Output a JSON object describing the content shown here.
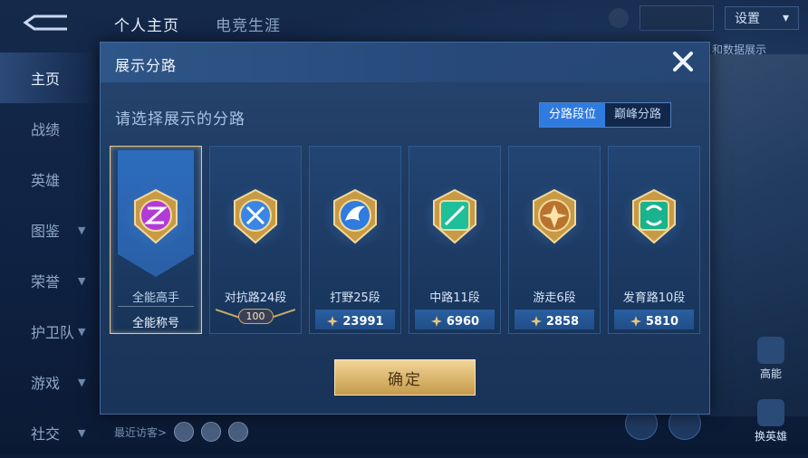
{
  "app": {
    "top_tabs": [
      "个人主页",
      "电竞生涯"
    ],
    "settings_label": "设置",
    "sidebar": [
      {
        "label": "主页",
        "has_chevron": false
      },
      {
        "label": "战绩",
        "has_chevron": false
      },
      {
        "label": "英雄",
        "has_chevron": false
      },
      {
        "label": "图鉴",
        "has_chevron": true
      },
      {
        "label": "荣誉",
        "has_chevron": true
      },
      {
        "label": "护卫队",
        "has_chevron": true
      },
      {
        "label": "游戏",
        "has_chevron": true
      },
      {
        "label": "社交",
        "has_chevron": true
      }
    ],
    "recent_visitors_label": "最近访客>",
    "behind_text": "和数据展示",
    "right_buttons": [
      "高能",
      "换英雄"
    ]
  },
  "modal": {
    "title": "展示分路",
    "subtitle": "请选择展示的分路",
    "toggle": {
      "options": [
        "分路段位",
        "巅峰分路"
      ],
      "active": 0
    },
    "confirm_label": "确定",
    "cards": [
      {
        "name": "全能高手",
        "foot": "全能称号",
        "foot_type": "title",
        "selected": true,
        "emblem": "all-round-emblem-icon",
        "color": "#b23ad8"
      },
      {
        "name": "对抗路24段",
        "foot": "100",
        "foot_type": "rank",
        "selected": false,
        "emblem": "clash-lane-emblem-icon",
        "color": "#3a86e6"
      },
      {
        "name": "打野25段",
        "foot": "23991",
        "foot_type": "score",
        "selected": false,
        "emblem": "jungle-emblem-icon",
        "color": "#2f7be0"
      },
      {
        "name": "中路11段",
        "foot": "6960",
        "foot_type": "score",
        "selected": false,
        "emblem": "mid-lane-emblem-icon",
        "color": "#1fbf9a"
      },
      {
        "name": "游走6段",
        "foot": "2858",
        "foot_type": "score",
        "selected": false,
        "emblem": "roam-emblem-icon",
        "color": "#b8742e"
      },
      {
        "name": "发育路10段",
        "foot": "5810",
        "foot_type": "score",
        "selected": false,
        "emblem": "farm-lane-emblem-icon",
        "color": "#19b38e"
      }
    ]
  }
}
